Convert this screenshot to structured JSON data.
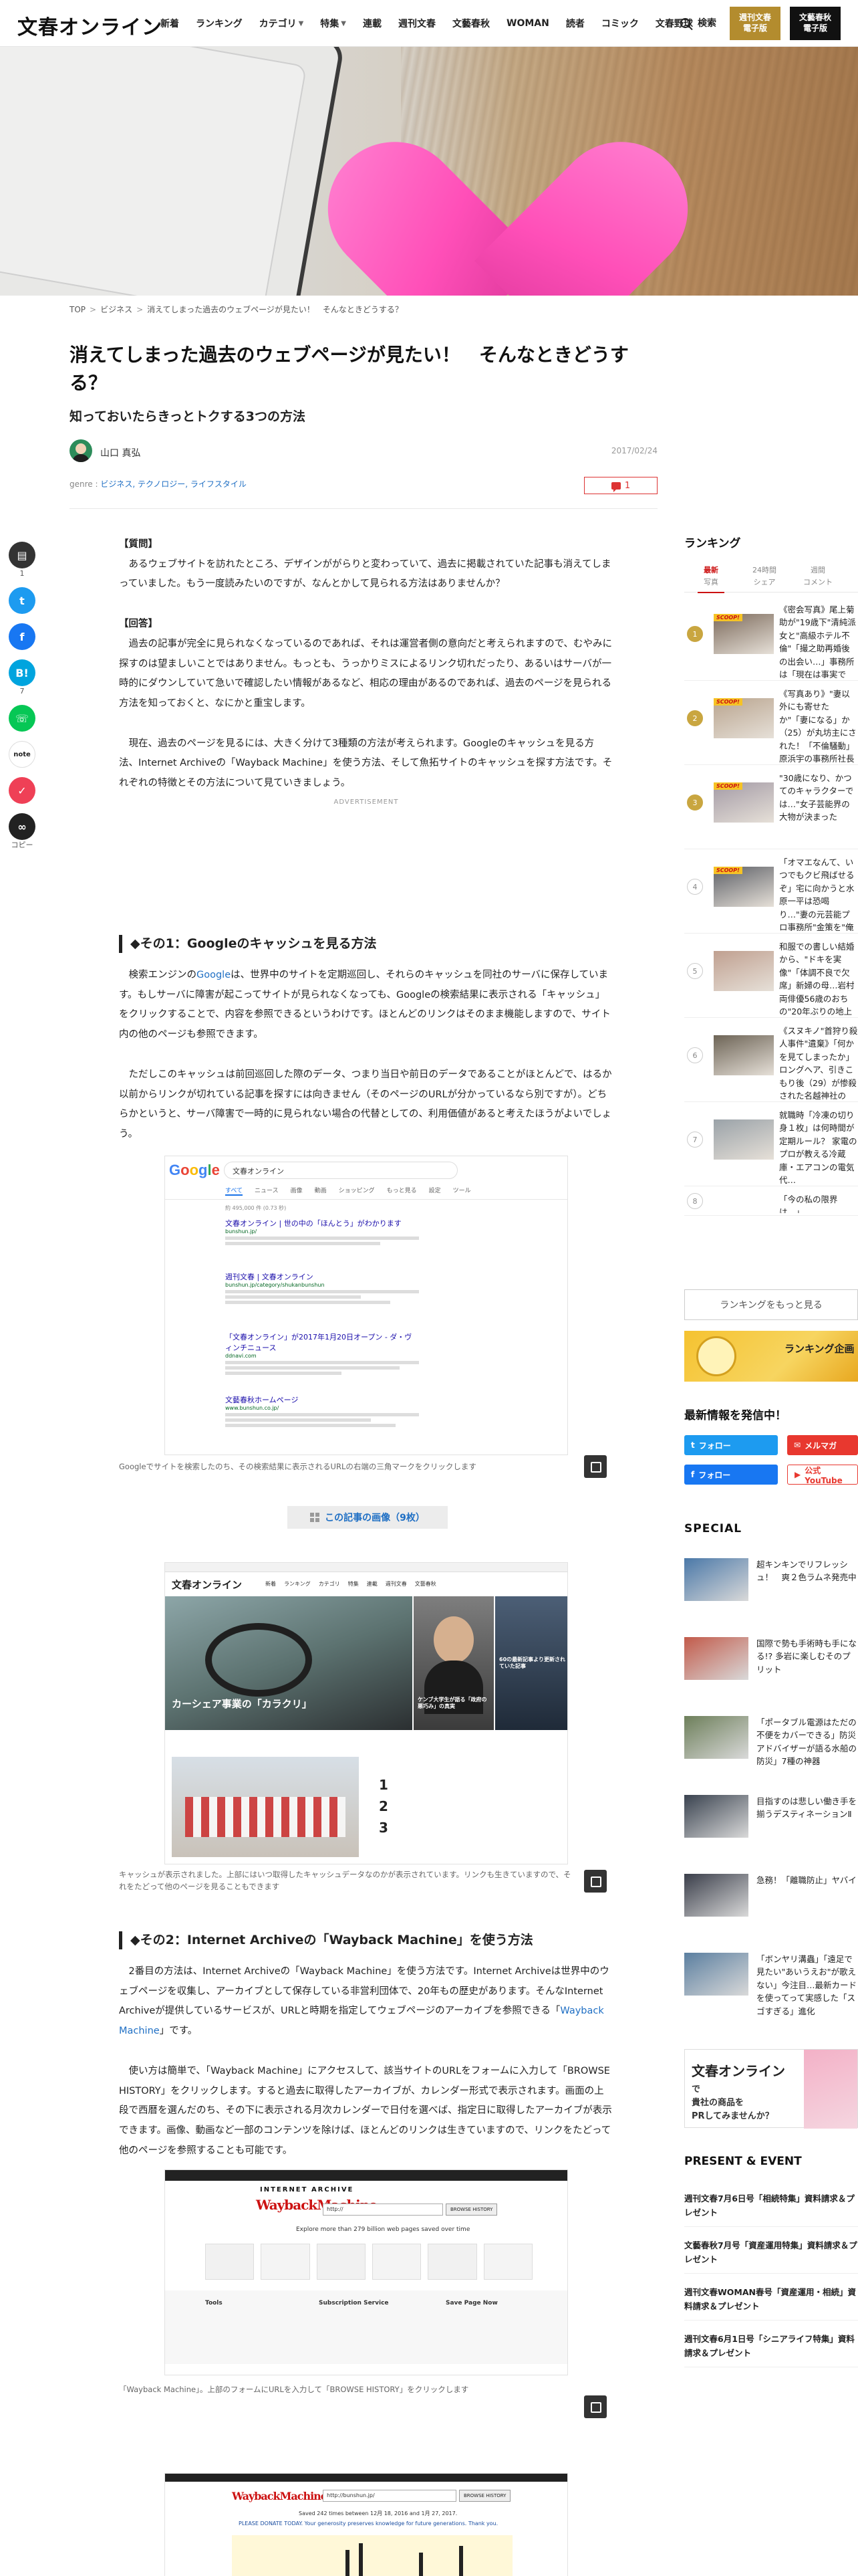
{
  "header": {
    "logo": "文春オンライン",
    "nav": [
      "新着",
      "ランキング",
      "カテゴリ",
      "特集",
      "連載",
      "週刊文春",
      "文藝春秋",
      "WOMAN",
      "読者",
      "コミック",
      "文春野球"
    ],
    "nav_caret": "▼",
    "search_label": "検索",
    "btn_weekly": "週刊文春\n電子版",
    "btn_bungei": "文藝春秋\n電子版"
  },
  "breadcrumb": [
    "TOP",
    "ビジネス",
    "消えてしまった過去のウェブページが見たい！　そんなときどうする？"
  ],
  "breadcrumb_sep": ">",
  "article": {
    "title": "消えてしまった過去のウェブページが見たい！　そんなときどうする？",
    "subtitle": "知っておいたらきっとトクする3つの方法",
    "author": "山口 真弘",
    "date": "2017/02/24",
    "genre_label": "genre :",
    "genres": "ビジネス, テクノロジー, ライフスタイル",
    "comment_count": "1",
    "q_label": "【質問】",
    "q_text": "　あるウェブサイトを訪れたところ、デザインががらりと変わっていて、過去に掲載されていた記事も消えてしまっていました。もう一度読みたいのですが、なんとかして見られる方法はありませんか？",
    "a_label": "【回答】",
    "a_text": "　過去の記事が完全に見られなくなっているのであれば、それは運営者側の意向だと考えられますので、むやみに探すのは望ましいことではありません。もっとも、うっかりミスによるリンク切れだったり、あるいはサーバが一時的にダウンしていて急いで確認したい情報があるなど、相応の理由があるのであれば、過去のページを見られる方法を知っておくと、なにかと重宝します。",
    "p1": "　現在、過去のページを見るには、大きく分けて3種類の方法が考えられます。Googleのキャッシュを見る方法、Internet Archiveの「Wayback Machine」を使う方法、そして魚拓サイトのキャッシュを探す方法です。それぞれの特徴とその方法について見ていきましょう。",
    "advert": "ADVERTISEMENT",
    "h1": "◆その1：Googleのキャッシュを見る方法",
    "s1p1_a": "　検索エンジンの",
    "s1p1_link": "Google",
    "s1p1_b": "は、世界中のサイトを定期巡回し、それらのキャッシュを同社のサーバに保存しています。もしサーバに障害が起こってサイトが見られなくなっても、Googleの検索結果に表示される「キャッシュ」をクリックすることで、内容を参照できるというわけです。ほとんどのリンクはそのまま機能しますので、サイト内の他のページも参照できます。",
    "s1p2": "　ただしこのキャッシュは前回巡回した際のデータ、つまり当日や前日のデータであることがほとんどで、はるか以前からリンクが切れている記事を探すには向きません（そのページのURLが分かっているなら別ですが）。どちらかというと、サーバ障害で一時的に見られない場合の代替としての、利用価値があると考えたほうがよいでしょう。",
    "fig1_caption": "Googleでサイトを検索したのち、その検索結果に表示されるURLの右端の三角マークをクリックします",
    "gallery_btn": "この記事の画像（9枚）",
    "fig2_caption": "キャッシュが表示されました。上部にはいつ取得したキャッシュデータなのかが表示されています。リンクも生きていますので、それをたどって他のページを見ることもできます",
    "h2": "◆その2：Internet Archiveの「Wayback Machine」を使う方法",
    "s2p1_a": "　2番目の方法は、Internet Archiveの「Wayback Machine」を使う方法です。Internet Archiveは世界中のウェブページを収集し、アーカイブとして保存している非営利団体で、20年もの歴史があります。そんなInternet Archiveが提供しているサービスが、URLと時期を指定してウェブページのアーカイブを参照できる「",
    "s2p1_link": "Wayback Machine",
    "s2p1_b": "」です。",
    "s2p2": "　使い方は簡単で、「Wayback Machine」にアクセスして、該当サイトのURLをフォームに入力して「BROWSE HISTORY」をクリックします。すると過去に取得したアーカイブが、カレンダー形式で表示されます。画面の上段で西暦を選んだのち、その下に表示される月次カレンダーで日付を選べば、指定日に取得したアーカイブが表示できます。画像、動画など一部のコンテンツを除けば、ほとんどのリンクは生きていますので、リンクをたどって他のページを参照することも可能です。",
    "fig3_caption": "「Wayback Machine」。上部のフォームにURLを入力して「BROWSE HISTORY」をクリックします"
  },
  "mock_google": {
    "logo": "Google",
    "query": "文春オンライン",
    "tabs": [
      "すべて",
      "ニュース",
      "画像",
      "動画",
      "ショッピング",
      "もっと見る",
      "設定",
      "ツール"
    ],
    "stats": "約 495,000 件 (0.73 秒)",
    "results": [
      {
        "title": "文春オンライン | 世の中の「ほんとう」がわかります",
        "url": "bunshun.jp/"
      },
      {
        "title": "週刊文春 | 文春オンライン",
        "url": "bunshun.jp/category/shukanbunshun"
      },
      {
        "title": "「文春オンライン」が2017年1月20日オープン - ダ・ヴィンチニュース",
        "url": "ddnavi.com"
      },
      {
        "title": "文藝春秋ホームページ",
        "url": "www.bunshun.co.jp/"
      }
    ]
  },
  "mock_site": {
    "logo": "文春オンライン",
    "nav": [
      "新着",
      "ランキング",
      "カテゴリ",
      "特集",
      "連載",
      "週刊文春",
      "文藝春秋"
    ],
    "feature_cap": "カーシェア事業の「カラクリ」",
    "feature_cap2": "ケンブ大学生が語る「政府の悪巧み」の真実",
    "feature_cap3": "60の最新記事より更新されていた記事"
  },
  "mock_archive": {
    "logo": "INTERNET ARCHIVE",
    "wordmark": "WaybackMachine",
    "url_placeholder": "http://",
    "history_btn": "BROWSE HISTORY",
    "explore": "Explore more than 279 billion web pages saved over time",
    "cols": [
      "Tools",
      "Subscription Service",
      "Save Page Now"
    ],
    "wordmark2": "WaybackMachine",
    "url2": "http://bunshun.jp/",
    "saved": "Saved 242 times between 12月 18, 2016 and 1月 27, 2017.",
    "donate": "PLEASE DONATE TODAY. Your generosity preserves knowledge for future generations. Thank you."
  },
  "share": {
    "comment_count": "1",
    "hatena_count": "7",
    "copy_label": "コピー",
    "note_label": "note"
  },
  "sidebar": {
    "ranking_title": "ランキング",
    "tabs": [
      {
        "line1": "最新",
        "line2": "写真"
      },
      {
        "line1": "24時間",
        "line2": "シェア"
      },
      {
        "line1": "週間",
        "line2": "コメント"
      }
    ],
    "scoop_label": "SCOOP!",
    "ranks": [
      {
        "num": "1",
        "text": "《密会写真》尾上菊助が\"19歳下\"清純派女と\"高級ホテル不倫\"「撮之助再婚後の出会い…」事務所は「現在は事実です」",
        "scoop": true
      },
      {
        "num": "2",
        "text": "《写真あり》\"妻以外にも寄せたか\"「妻になる」か（25）が丸坊主にされた！「不倫騒動」原浜宇の事務所社長も「バリカン入れて…」",
        "scoop": true
      },
      {
        "num": "3",
        "text": "\"30歳になり、かつてのキャラクターでは…\"女子芸能界の大物が決まった",
        "scoop": true
      },
      {
        "num": "4",
        "text": "「オマエなんて、いつでもクビ飛ばせるぞ」宅に向かうと水原一平は恐喝り…\"妻の元芸能プロ事務所\"金策を\"俺に伝説の取調室\"が実発！",
        "scoop": true
      },
      {
        "num": "5",
        "text": "和服での書しい結婚から、\"ドキを実像\"「体調不良で欠席」新婦の母…岩村両俳優56歳のおちの\"20年ぶりの地上波ドラマ主演\"",
        "scoop": false
      },
      {
        "num": "6",
        "text": "《スヌキノ\"首狩り殺人事件\"遺棄》「何かを見てしまったか」ロングへア、引きこもり後（29）が惨殺された名越神社の元・元夫事件後起きた「異変」と容疑者はバンドにも…",
        "scoop": false
      },
      {
        "num": "7",
        "text": "就職時「冷凍の切り身１枚」は何時間が定期ルール？ 家電のプロが教える冷蔵庫・エアコンの電気代…",
        "scoop": false
      },
      {
        "num": "8",
        "text": "「今の私の限界は…」",
        "scoop": false
      }
    ],
    "more_ranking": "ランキングをもっと見る",
    "banner_text": "ランキング企画",
    "latest_title": "最新情報を発信中！",
    "follow": [
      {
        "label": "フォロー",
        "color": "#1d9bf0"
      },
      {
        "label": "メルマガ",
        "color": "#e8382f"
      },
      {
        "label": "フォロー",
        "color": "#1877f2"
      },
      {
        "label": "公式YouTube",
        "color": "#e8382f"
      }
    ],
    "special_title": "SPECIAL",
    "specials": [
      "超キンキンでリフレッシュ！　爽２色ラムネ発売中",
      "国際で勢も手術時も手になる!? 多岩に楽しむそのプリット",
      "「ポータブル電源はただの不便をカバーできる」防災アドバイザーが語る水船の防災」7種の神器",
      "目指すのは悲しい働き手を揃うデスティネーションⅡ",
      "急務！「離職防止」ヤバイ",
      "「ボンヤリ溝蟲」「遠足で見たい\"あいうえお\"が歌えない」今注目…最新カードを使ってって実感した「スゴすぎる」進化"
    ],
    "pr_logo": "文春オンライン",
    "pr_text": "で\n貴社の商品を\nPRしてみませんか？",
    "pe_title": "PRESENT & EVENT",
    "pe": [
      "週刊文春7月6日号「相続特集」資料請求＆プレゼント",
      "文藝春秋7月号「資産運用特集」資料請求＆プレゼント",
      "週刊文春WOMAN春号「資産運用・相続」資料請求＆プレゼント",
      "週刊文春6月1日号「シニアライフ特集」資料請求＆プレゼント"
    ]
  },
  "colors": {
    "accent_red": "#cc1111",
    "gold": "#b38c2e",
    "link": "#1f6fc4"
  }
}
